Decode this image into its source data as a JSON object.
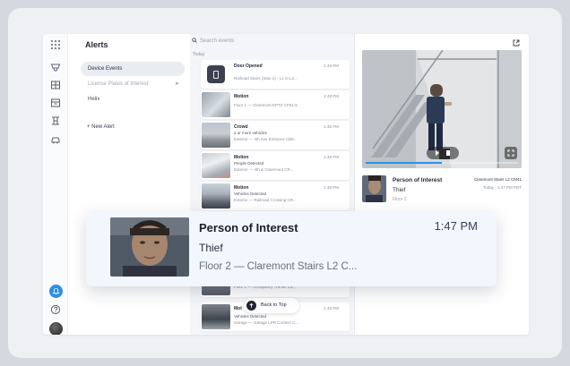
{
  "nav_rail": {
    "icons": [
      "grid-icon",
      "funnel-icon",
      "layout-icon",
      "archive-icon",
      "access-control-icon",
      "vehicle-icon"
    ],
    "notification_color": "#2f8fe3"
  },
  "sidebar": {
    "title": "Alerts",
    "items": [
      {
        "label": "Device Events",
        "active": true
      },
      {
        "label": "License Plates of Interest",
        "pinned": true
      },
      {
        "label": "Helix"
      }
    ],
    "new_alert": "+  New Alert"
  },
  "search": {
    "placeholder": "Search events"
  },
  "list": {
    "section": "Today",
    "events": [
      {
        "title": "Door Opened",
        "subtitle": "",
        "location": "Railroad Stairs (Stair 1) - L1 to L2...",
        "time": "1:49 PM"
      },
      {
        "title": "Motion",
        "subtitle": "",
        "location": "Floor 1 — Claremont EPTZ CF81-8",
        "time": "1:48 PM"
      },
      {
        "title": "Crowd",
        "subtitle": "2 or more vehicles",
        "location": "Exterior — 4th Ave Entrance CB5...",
        "time": "1:48 PM"
      },
      {
        "title": "Motion",
        "subtitle": "People Detected",
        "location": "Exterior — 4th & Claremont CR...",
        "time": "1:48 PM"
      },
      {
        "title": "Motion",
        "subtitle": "Vehicles Detected",
        "location": "Exterior — Railroad Crossing CR...",
        "time": "1:48 PM"
      },
      {
        "title": "",
        "subtitle": "",
        "location": "Floor 1 — Occupancy Trends Ca...",
        "time": ""
      },
      {
        "title": "Mot",
        "subtitle": "Vehicles Detected",
        "location": "Garage — Garage LPR Context C...",
        "time": "1:46 PM"
      }
    ],
    "back_to_top": "Back to Top"
  },
  "detail": {
    "title": "Person of Interest",
    "subtitle": "Thief",
    "location": "Floor 2",
    "camera": "Claremont Stairs L2 CM41",
    "time": "Today · 1:47 PM PDT",
    "playback_progress_pct": 50
  },
  "popup": {
    "title": "Person of Interest",
    "time": "1:47 PM",
    "subtitle": "Thief",
    "location": "Floor 2 — Claremont Stairs L2 C..."
  }
}
